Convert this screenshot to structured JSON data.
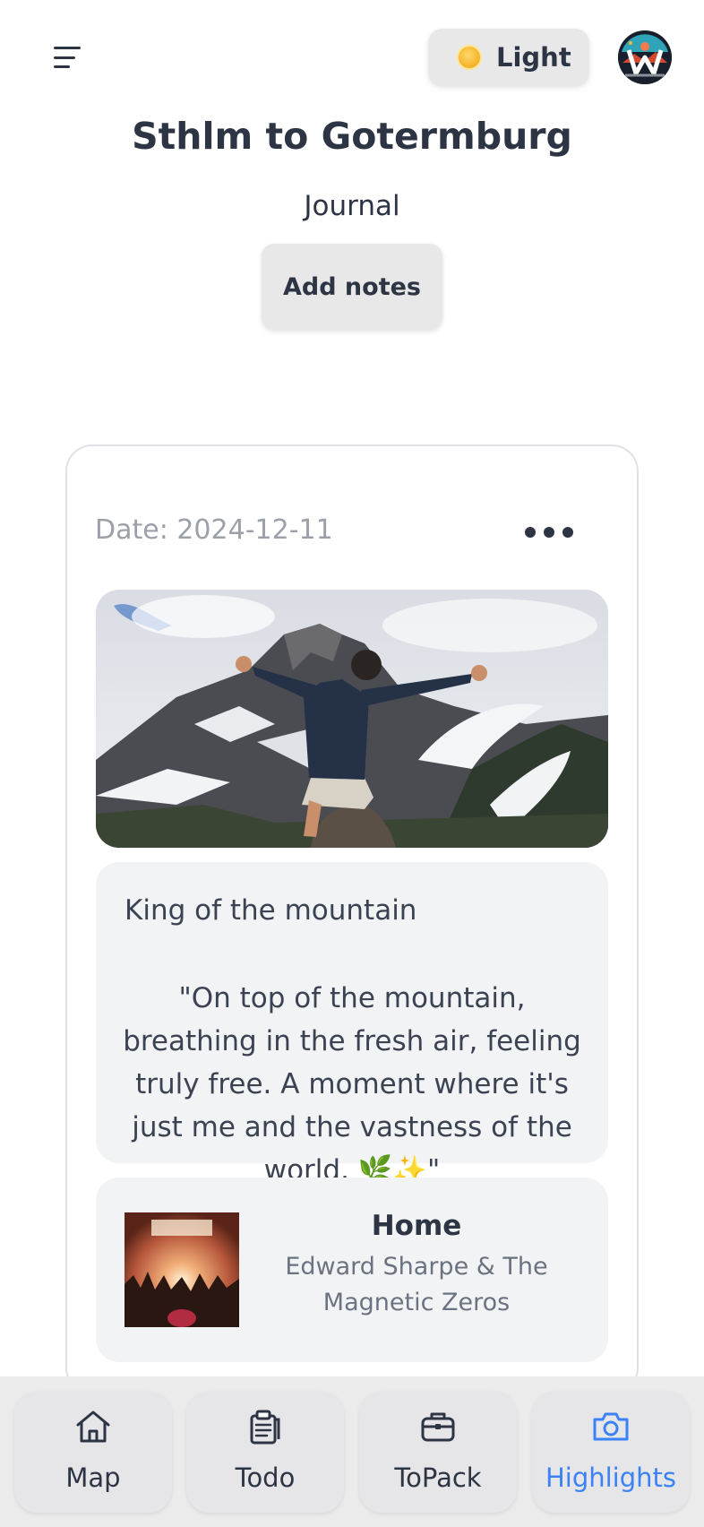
{
  "header": {
    "theme_label": "Light",
    "theme_icon": "sun-icon",
    "menu_icon": "hamburger-menu-icon"
  },
  "trip": {
    "title": "Sthlm to Gotermburg",
    "subtitle": "Journal",
    "add_notes_label": "Add notes"
  },
  "entry": {
    "date": "Date: 2024-12-11",
    "more_icon": "ellipsis-icon",
    "photo": "man-on-mountain-photo",
    "note_title": "King of the mountain",
    "note_body": "\"On top of the mountain, breathing in the fresh air, feeling truly free. A moment where it's just me and the vastness of the world. 🌿✨\"",
    "song": {
      "title": "Home",
      "artist": "Edward Sharpe & The Magnetic Zeros"
    }
  },
  "nav": {
    "items": [
      {
        "label": "Map",
        "icon": "house-icon",
        "active": false
      },
      {
        "label": "Todo",
        "icon": "clipboard-icon",
        "active": false
      },
      {
        "label": "ToPack",
        "icon": "briefcase-icon",
        "active": false
      },
      {
        "label": "Highlights",
        "icon": "camera-icon",
        "active": true
      }
    ]
  },
  "colors": {
    "accent": "#3b82f6",
    "text": "#2d3444",
    "muted": "#9ca0a8",
    "panel": "#f2f3f5"
  }
}
